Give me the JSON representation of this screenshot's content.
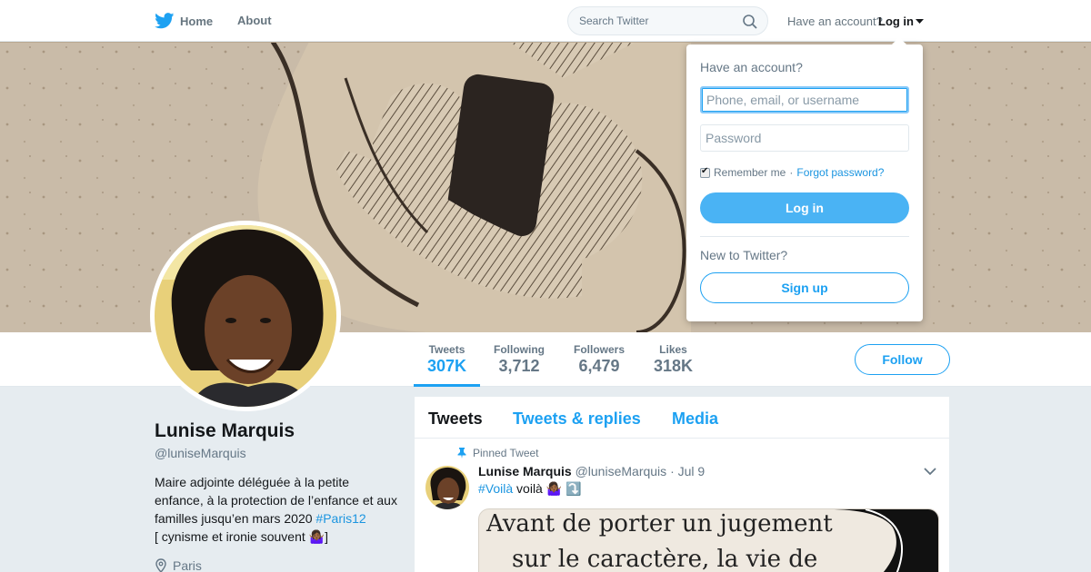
{
  "nav": {
    "home_label": "Home",
    "about_label": "About",
    "search_placeholder": "Search Twitter",
    "have_account": "Have an account?",
    "login_label": "Log in"
  },
  "colors": {
    "accent": "#1da1f2",
    "link": "#1b95e0",
    "background": "#e6ecf0"
  },
  "login_dropdown": {
    "title": "Have an account?",
    "username_placeholder": "Phone, email, or username",
    "password_placeholder": "Password",
    "remember_label": "Remember me",
    "separator": "·",
    "forgot_label": "Forgot password?",
    "login_button": "Log in",
    "new_label": "New to Twitter?",
    "signup_button": "Sign up"
  },
  "profile": {
    "name": "Lunise Marquis",
    "handle": "@luniseMarquis",
    "bio_text": "Maire adjointe déléguée à la petite enfance, à la protection de l’enfance et aux familles jusqu’en mars 2020 ",
    "bio_hashtag": "#Paris12",
    "bio_text2": "[ cynisme et ironie souvent ",
    "bio_emoji": "🤷🏾‍♀️",
    "bio_text3": "]",
    "location": "Paris",
    "follow_label": "Follow"
  },
  "stats": [
    {
      "label": "Tweets",
      "value": "307K",
      "active": true
    },
    {
      "label": "Following",
      "value": "3,712"
    },
    {
      "label": "Followers",
      "value": "6,479"
    },
    {
      "label": "Likes",
      "value": "318K"
    }
  ],
  "timeline": {
    "tabs": [
      "Tweets",
      "Tweets & replies",
      "Media"
    ],
    "pinned_label": "Pinned Tweet",
    "tweet": {
      "author": "Lunise Marquis",
      "handle": "@luniseMarquis",
      "dot": "·",
      "date": "Jul 9",
      "hashtag": "#Voilà",
      "text": " voilà 🤷🏾‍♀️ ⤵️",
      "image_line1": "Avant de porter un jugement",
      "image_line2": "sur le caractère, la vie de"
    }
  }
}
